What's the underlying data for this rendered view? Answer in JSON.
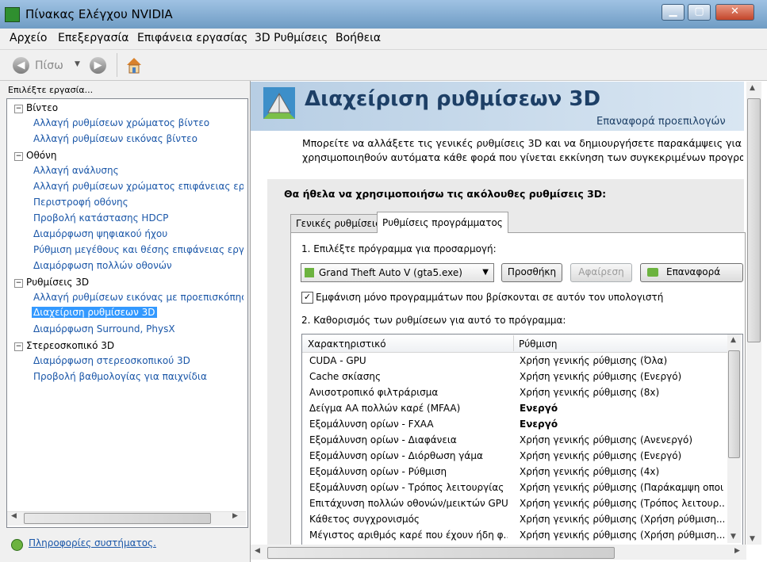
{
  "window": {
    "title": "Πίνακας Ελέγχου NVIDIA"
  },
  "menu": [
    "Αρχείο",
    "Επεξεργασία",
    "Επιφάνεια εργασίας",
    "3D Ρυθμίσεις",
    "Βοήθεια"
  ],
  "toolbar": {
    "back_label": "Πίσω"
  },
  "sidebar": {
    "task_label": "Επιλέξτε εργασία...",
    "categories": [
      {
        "label": "Βίντεο",
        "items": [
          "Αλλαγή ρυθμίσεων χρώματος βίντεο",
          "Αλλαγή ρυθμίσεων εικόνας βίντεο"
        ]
      },
      {
        "label": "Οθόνη",
        "items": [
          "Αλλαγή ανάλυσης",
          "Αλλαγή ρυθμίσεων χρώματος επιφάνειας εργα",
          "Περιστροφή οθόνης",
          "Προβολή κατάστασης HDCP",
          "Διαμόρφωση ψηφιακού ήχου",
          "Ρύθμιση μεγέθους και θέσης επιφάνειας εργασ",
          "Διαμόρφωση πολλών οθονών"
        ]
      },
      {
        "label": "Ρυθμίσεις 3D",
        "items": [
          "Αλλαγή ρυθμίσεων εικόνας με προεπισκόπηση",
          "Διαχείριση ρυθμίσεων 3D",
          "Διαμόρφωση Surround, PhysX"
        ]
      },
      {
        "label": "Στερεοσκοπικό 3D",
        "items": [
          "Διαμόρφωση στερεοσκοπικού 3D",
          "Προβολή βαθμολογίας για παιχνίδια"
        ]
      }
    ],
    "selected_item": "Διαχείριση ρυθμίσεων 3D",
    "system_info": "Πληροφορίες συστήματος."
  },
  "main": {
    "title": "Διαχείριση ρυθμίσεων 3D",
    "restore_defaults": "Επαναφορά προεπιλογών",
    "intro_line1": "Μπορείτε να αλλάξετε τις γενικές ρυθμίσεις 3D και να δημιουργήσετε παρακάμψεις για ειδικά",
    "intro_line2": "χρησιμοποιηθούν αυτόματα κάθε φορά που γίνεται εκκίνηση των συγκεκριμένων προγραμμάτ",
    "prompt": "Θα ήθελα να χρησιμοποιήσω τις ακόλουθες ρυθμίσεις 3D:",
    "tabs": [
      "Γενικές ρυθμίσεις",
      "Ρυθμίσεις προγράμματος"
    ],
    "active_tab": "Ρυθμίσεις προγράμματος",
    "step1": "1. Επιλέξτε πρόγραμμα για προσαρμογή:",
    "program_selected": "Grand Theft Auto V (gta5.exe)",
    "add_button": "Προσθήκη",
    "remove_button": "Αφαίρεση",
    "restore_button": "Επαναφορά",
    "checkbox_label": "Εμφάνιση μόνο προγραμμάτων που βρίσκονται σε αυτόν τον υπολογιστή",
    "checkbox_checked": true,
    "step2": "2. Καθορισμός των ρυθμίσεων για αυτό το πρόγραμμα:",
    "table": {
      "headers": [
        "Χαρακτηριστικό",
        "Ρύθμιση"
      ],
      "rows": [
        {
          "feature": "CUDA - GPU",
          "setting": "Χρήση γενικής ρύθμισης (Όλα)",
          "bold": false
        },
        {
          "feature": "Cache σκίασης",
          "setting": "Χρήση γενικής ρύθμισης (Ενεργό)",
          "bold": false
        },
        {
          "feature": "Ανισοτροπικό φιλτράρισμα",
          "setting": "Χρήση γενικής ρύθμισης (8x)",
          "bold": false
        },
        {
          "feature": "Δείγμα AA πολλών καρέ (MFAA)",
          "setting": "Ενεργό",
          "bold": true
        },
        {
          "feature": "Εξομάλυνση ορίων - FXAA",
          "setting": "Ενεργό",
          "bold": true
        },
        {
          "feature": "Εξομάλυνση ορίων - Διαφάνεια",
          "setting": "Χρήση γενικής ρύθμισης (Ανενεργό)",
          "bold": false
        },
        {
          "feature": "Εξομάλυνση ορίων - Διόρθωση γάμα",
          "setting": "Χρήση γενικής ρύθμισης (Ενεργό)",
          "bold": false
        },
        {
          "feature": "Εξομάλυνση ορίων - Ρύθμιση",
          "setting": "Χρήση γενικής ρύθμισης (4x)",
          "bold": false
        },
        {
          "feature": "Εξομάλυνση ορίων - Τρόπος λειτουργίας",
          "setting": "Χρήση γενικής ρύθμισης (Παράκαμψη οποι...",
          "bold": false
        },
        {
          "feature": "Επιτάχυνση πολλών οθονών/μεικτών GPU",
          "setting": "Χρήση γενικής ρύθμισης (Τρόπος λειτουρ...",
          "bold": false
        },
        {
          "feature": "Κάθετος συγχρονισμός",
          "setting": "Χρήση γενικής ρύθμισης (Χρήση ρύθμιση...",
          "bold": false
        },
        {
          "feature": "Μέγιστος αριθμός καρέ που έχουν ήδη φ...",
          "setting": "Χρήση γενικής ρύθμισης (Χρήση ρύθμιση...",
          "bold": false
        }
      ]
    }
  },
  "colors": {
    "link": "#1b57a8",
    "selection": "#3399ff",
    "header_title": "#1d3f66"
  }
}
